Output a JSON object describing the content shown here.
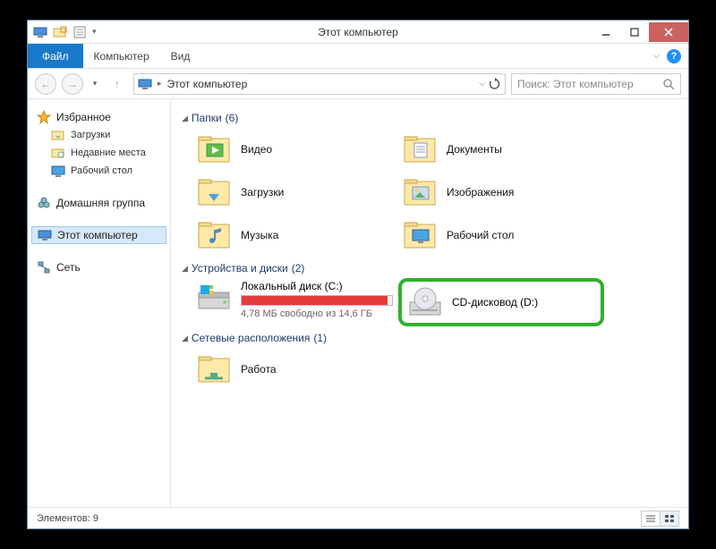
{
  "title": "Этот компьютер",
  "menubar": {
    "file": "Файл",
    "computer": "Компьютер",
    "view": "Вид"
  },
  "address": {
    "crumb": "Этот компьютер"
  },
  "search": {
    "placeholder": "Поиск: Этот компьютер"
  },
  "sidebar": {
    "favorites": {
      "label": "Избранное",
      "items": [
        "Загрузки",
        "Недавние места",
        "Рабочий стол"
      ]
    },
    "homegroup": "Домашняя группа",
    "thispc": "Этот компьютер",
    "network": "Сеть"
  },
  "sections": {
    "folders": {
      "label": "Папки",
      "count": "(6)"
    },
    "devices": {
      "label": "Устройства и диски",
      "count": "(2)"
    },
    "netloc": {
      "label": "Сетевые расположения",
      "count": "(1)"
    }
  },
  "folders": [
    "Видео",
    "Документы",
    "Загрузки",
    "Изображения",
    "Музыка",
    "Рабочий стол"
  ],
  "drives": {
    "local": {
      "label": "Локальный диск (C:)",
      "status": "4,78 МБ свободно из 14,6 ГБ"
    },
    "cd": {
      "label": "CD-дисковод (D:)"
    }
  },
  "netitems": [
    "Работа"
  ],
  "statusbar": {
    "items": "Элементов: 9"
  }
}
